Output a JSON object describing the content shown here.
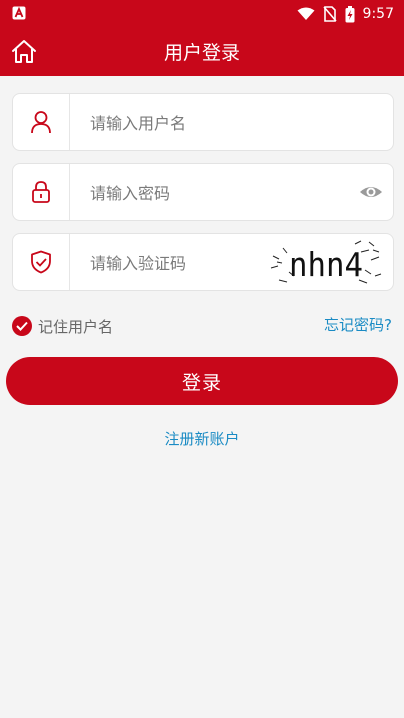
{
  "status_bar": {
    "time": "9:57",
    "icons": [
      "app-notification-icon",
      "wifi-icon",
      "no-sim-icon",
      "battery-charging-icon"
    ]
  },
  "header": {
    "title": "用户登录",
    "home_icon": "home-icon"
  },
  "form": {
    "username": {
      "placeholder": "请输入用户名",
      "value": "",
      "icon": "user-icon"
    },
    "password": {
      "placeholder": "请输入密码",
      "value": "",
      "icon": "lock-icon",
      "toggle_icon": "eye-icon"
    },
    "captcha": {
      "placeholder": "请输入验证码",
      "value": "",
      "icon": "shield-check-icon",
      "image_text": "nhn4"
    }
  },
  "remember": {
    "label": "记住用户名",
    "checked": true
  },
  "forgot_link": "忘记密码?",
  "login_button": "登录",
  "register_link": "注册新账户",
  "colors": {
    "primary": "#c8071a",
    "link": "#1a8bc4",
    "background": "#f4f4f4"
  }
}
